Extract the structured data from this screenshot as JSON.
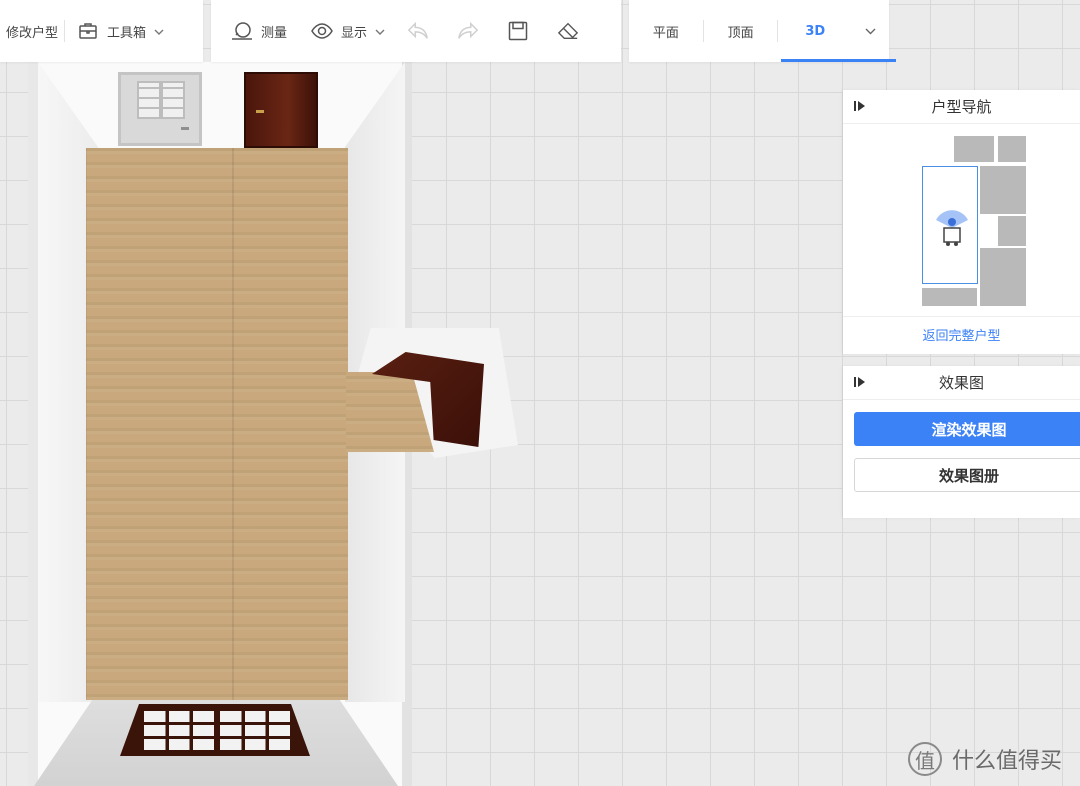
{
  "toolbar": {
    "edit_floorplan": "修改户型",
    "toolbox": "工具箱",
    "measure": "测量",
    "display": "显示"
  },
  "view_tabs": [
    "平面",
    "顶面",
    "3D"
  ],
  "active_view": "3D",
  "nav_panel": {
    "title": "户型导航",
    "back_link": "返回完整户型"
  },
  "render_panel": {
    "title": "效果图",
    "render_button": "渲染效果图",
    "album_button": "效果图册"
  },
  "watermark": {
    "logo_char": "值",
    "text": "什么值得买"
  },
  "colors": {
    "accent": "#3b82f6",
    "floor": "#c8a87c",
    "door_dark": "#4b160c"
  }
}
